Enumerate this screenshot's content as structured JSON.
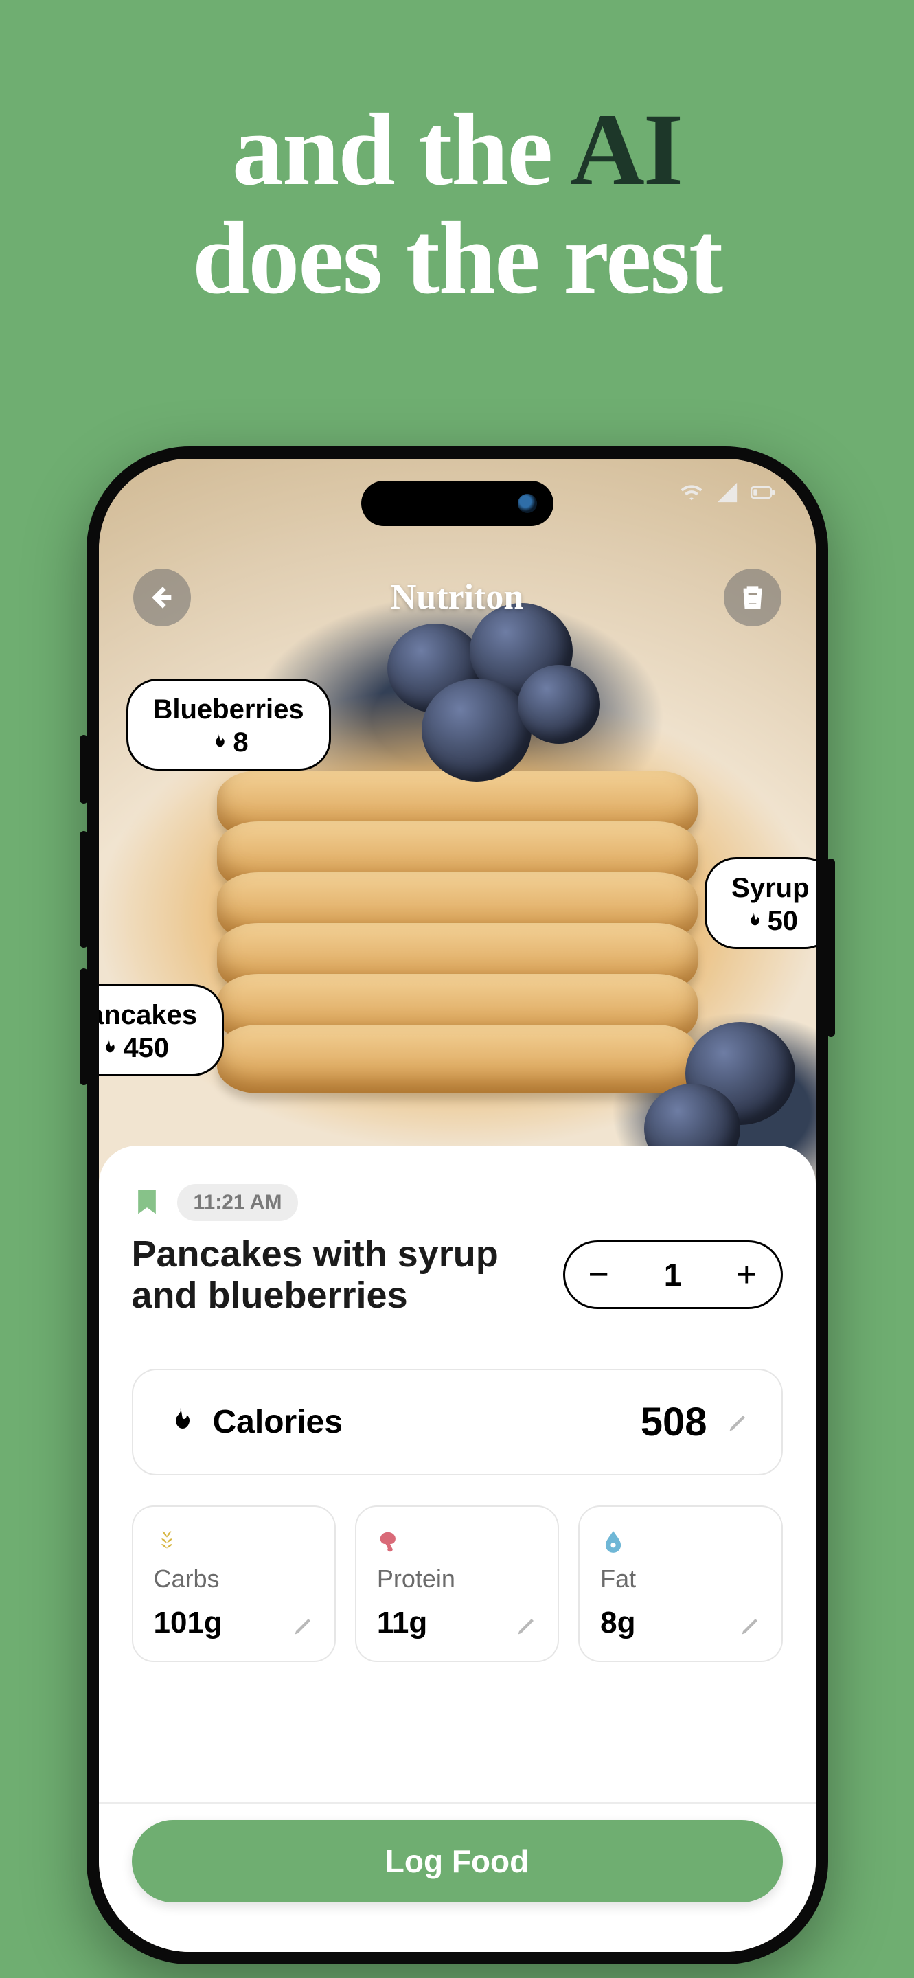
{
  "hero": {
    "line1_pre": "and the ",
    "ai": "AI",
    "line2": "does the rest"
  },
  "app": {
    "title": "Nutriton"
  },
  "detections": {
    "blueberries": {
      "name": "Blueberries",
      "calories": "8"
    },
    "syrup": {
      "name": "Syrup",
      "calories": "50"
    },
    "pancakes": {
      "name": "Pancakes",
      "calories": "450"
    }
  },
  "entry": {
    "timestamp": "11:21 AM",
    "title": "Pancakes with syrup and blueberries",
    "quantity": "1"
  },
  "nutrition": {
    "calories": {
      "label": "Calories",
      "value": "508"
    },
    "carbs": {
      "label": "Carbs",
      "value": "101g"
    },
    "protein": {
      "label": "Protein",
      "value": "11g"
    },
    "fat": {
      "label": "Fat",
      "value": "8g"
    }
  },
  "actions": {
    "log": "Log Food"
  }
}
